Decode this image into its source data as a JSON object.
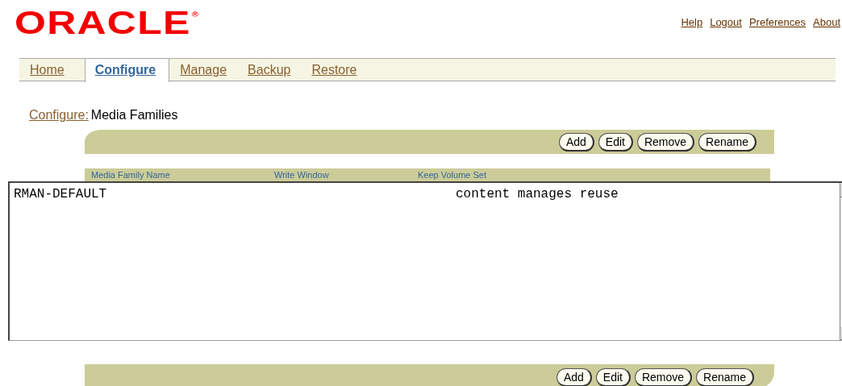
{
  "logo": {
    "text": "ORACLE",
    "mark": "®"
  },
  "global_links": [
    "Help",
    "Logout",
    "Preferences",
    "About"
  ],
  "tabs": [
    {
      "label": "Home",
      "selected": false
    },
    {
      "label": "Configure",
      "selected": true
    },
    {
      "label": "Manage",
      "selected": false
    },
    {
      "label": "Backup",
      "selected": false
    },
    {
      "label": "Restore",
      "selected": false
    }
  ],
  "breadcrumb": {
    "link": "Configure:",
    "current": "Media Families"
  },
  "top_toolbar": [
    "Add",
    "Edit",
    "Remove",
    "Rename"
  ],
  "table": {
    "columns": [
      "Media Family Name",
      "Write Window",
      "Keep Volume Set"
    ],
    "rows": [
      {
        "media_family_name": "RMAN-DEFAULT",
        "keep_volume_set": "content manages reuse"
      }
    ]
  },
  "bottom_toolbar": [
    "Add",
    "Edit",
    "Remove",
    "Rename"
  ]
}
